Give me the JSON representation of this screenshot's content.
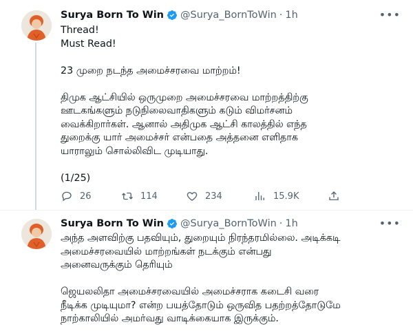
{
  "tweets": [
    {
      "author_name": "Surya Born To Win",
      "handle": "@Surya_BornToWin",
      "separator": "·",
      "time": "1h",
      "lines": [
        "Thread!",
        "Must Read!"
      ],
      "headline": "23 முறை நடந்த அமைச்சரவை மாற்றம்!",
      "paragraph_lines": [
        "திமுக ஆட்சியில் ஒருமுறை அமைச்சரவை மாற்றத்திற்கு",
        "ஊடகங்களும் நடுநிலைவாதிகளும் கடும் விமர்சனம்",
        "வைக்கிறார்கள். ஆனால் அதிமுக ஆட்சி காலத்தில் எந்த",
        "துறைக்கு யார் அமைச்சர் என்பதை அத்தனை எளிதாக",
        "யாராலும் சொல்லிவிட முடியாது."
      ],
      "counter": "(1/25)",
      "actions": {
        "reply_count": "26",
        "retweet_count": "114",
        "like_count": "234",
        "view_count": "15.9K"
      }
    },
    {
      "author_name": "Surya Born To Win",
      "handle": "@Surya_BornToWin",
      "separator": "·",
      "time": "1h",
      "paragraph1_lines": [
        "அந்த அளவிற்கு பதவியும், துறையும் நிரந்தரமில்லை. அடிக்கடி",
        "அமைச்சரவையில் மாற்றங்கள் நடக்கும் என்பது",
        "அனைவருக்கும் தெரியும்"
      ],
      "paragraph2_lines": [
        "ஜெயலலிதா அமைச்சரவையில் அமைச்சராக கடைசி வரை",
        "நீடிக்க முடியுமா? என்ற பயத்தோடும் ஒருவித பதற்றத்தோடுமே",
        "நாற்காலியில் அமர்வது வாடிக்கையாக இருக்கும்."
      ]
    }
  ],
  "colors": {
    "verified": "#1d9bf0",
    "text": "#0f1419",
    "muted": "#536471",
    "thread_line": "#cfd9de"
  },
  "icons": [
    "verified-badge-icon",
    "more-icon",
    "reply-icon",
    "retweet-icon",
    "like-icon",
    "views-icon",
    "share-icon"
  ]
}
